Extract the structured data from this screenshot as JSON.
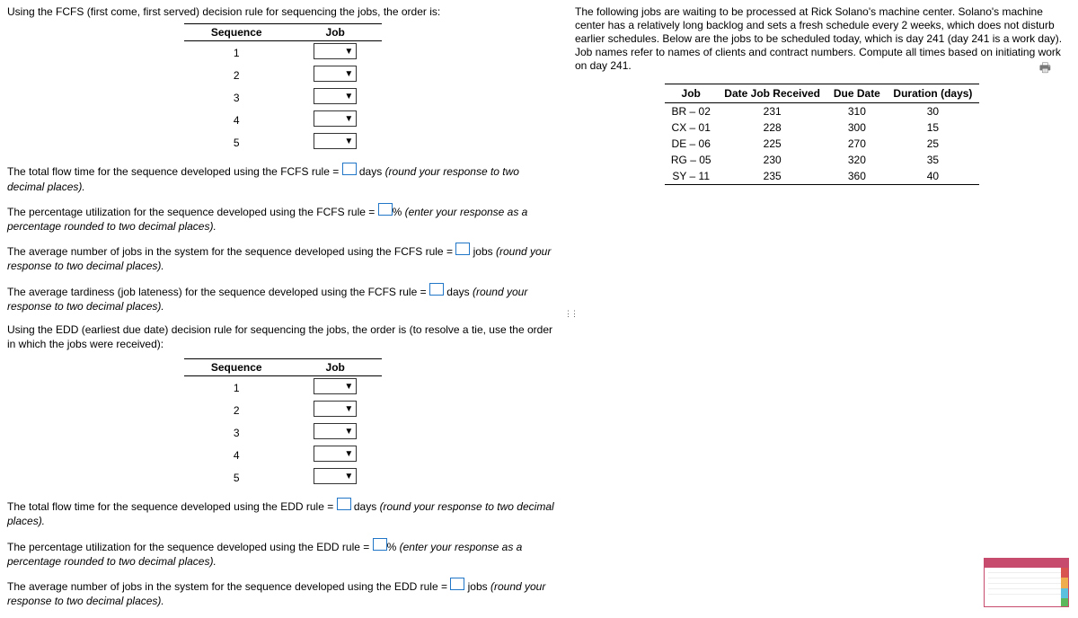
{
  "left": {
    "fcfs_heading": "Using the FCFS (first come, first served) decision rule for sequencing the jobs, the order is:",
    "seq_header_sequence": "Sequence",
    "seq_header_job": "Job",
    "rows": [
      "1",
      "2",
      "3",
      "4",
      "5"
    ],
    "p_flow_pre": "The total flow time for the sequence developed using the FCFS rule = ",
    "p_flow_post_a": " days ",
    "p_flow_post_b": "(round your response to two decimal places).",
    "p_util_pre": "The percentage utilization for the sequence developed using the FCFS rule = ",
    "p_util_post_a": "% ",
    "p_util_post_b": "(enter your response as a percentage rounded to two decimal places).",
    "p_avg_pre": "The average number of jobs in the system for the sequence developed using the FCFS rule = ",
    "p_avg_post_a": " jobs ",
    "p_avg_post_b": "(round your response to two decimal places).",
    "p_tard_pre": "The average tardiness (job lateness) for the sequence developed using the FCFS rule = ",
    "p_tard_post_a": " days ",
    "p_tard_post_b": "(round your response to two decimal places).",
    "edd_heading": "Using the EDD (earliest due date) decision rule for sequencing the jobs, the order is (to resolve a tie, use the order in which the jobs were received):",
    "e_flow_pre": "The total flow time for the sequence developed using the EDD rule = ",
    "e_flow_post_a": " days ",
    "e_flow_post_b": "(round your response to two decimal places).",
    "e_util_pre": "The percentage utilization for the sequence developed using the EDD rule = ",
    "e_util_post_a": "% ",
    "e_util_post_b": "(enter your response as a percentage rounded to two decimal places).",
    "e_avg_pre": "The average number of jobs in the system for the sequence developed using the EDD rule = ",
    "e_avg_post_a": " jobs ",
    "e_avg_post_b": "(round your response to two decimal places)."
  },
  "right": {
    "description": "The following jobs are waiting to be processed at Rick Solano's machine center. Solano's machine center has a relatively long backlog and sets a fresh schedule every 2 weeks, which does not disturb earlier schedules. Below are the jobs to be scheduled today, which is day 241 (day 241 is a work day). Job names refer to names of clients and contract numbers. Compute all times based on initiating work on day 241.",
    "th_job": "Job",
    "th_received": "Date Job Received",
    "th_due": "Due Date",
    "th_dur": "Duration (days)",
    "rows": [
      {
        "job": "BR – 02",
        "rec": "231",
        "due": "310",
        "dur": "30"
      },
      {
        "job": "CX – 01",
        "rec": "228",
        "due": "300",
        "dur": "15"
      },
      {
        "job": "DE – 06",
        "rec": "225",
        "due": "270",
        "dur": "25"
      },
      {
        "job": "RG – 05",
        "rec": "230",
        "due": "320",
        "dur": "35"
      },
      {
        "job": "SY – 11",
        "rec": "235",
        "due": "360",
        "dur": "40"
      }
    ]
  }
}
